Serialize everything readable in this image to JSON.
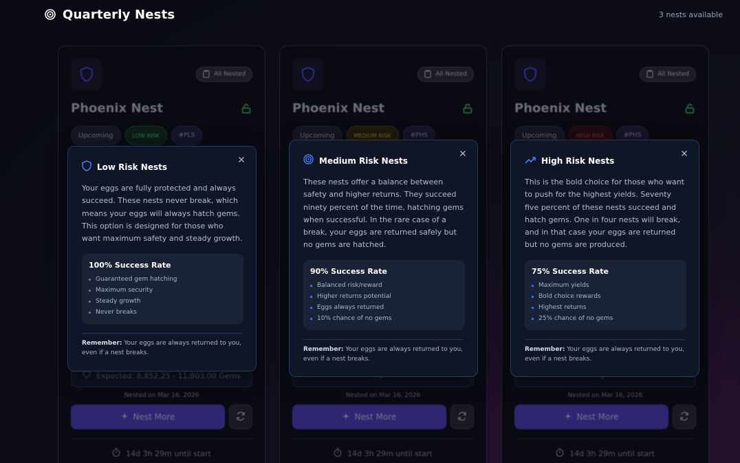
{
  "header": {
    "title": "Quarterly Nests",
    "nests_available": "3 nests available"
  },
  "cards": [
    {
      "all_nested": "All Nested",
      "title": "Phoenix Nest",
      "tags": {
        "status": "Upcoming",
        "risk": "LOW RISK",
        "token": "#PLS"
      },
      "expected": "Expected: 8,852.25 - 11,803.00 Gems",
      "nested_on": "Nested on Mar 16, 2026",
      "nest_button": "Nest More",
      "countdown": "14d 3h 29m until start"
    },
    {
      "all_nested": "All Nested",
      "title": "Phoenix Nest",
      "tags": {
        "status": "Upcoming",
        "risk": "MEDIUM RISK",
        "token": "#PHS"
      },
      "expected": "",
      "nested_on": "Nested on Mar 16, 2026",
      "nest_button": "Nest More",
      "countdown": "14d 3h 29m until start"
    },
    {
      "all_nested": "All Nested",
      "title": "Phoenix Nest",
      "tags": {
        "status": "Upcoming",
        "risk": "HIGH RISK",
        "token": "#PHS"
      },
      "expected": "",
      "nested_on": "Nested on Mar 16, 2026",
      "nest_button": "Nest More",
      "countdown": "14d 3h 29m until start"
    }
  ],
  "popups": [
    {
      "icon": "shield-icon",
      "title": "Low Risk Nests",
      "description": "Your eggs are fully protected and always succeed. These nests never break, which means your eggs will always hatch gems. This option is designed for those who want maximum safety and steady growth.",
      "rate_title": "100% Success Rate",
      "rate_items": [
        "Guaranteed gem hatching",
        "Maximum security",
        "Steady growth",
        "Never breaks"
      ],
      "remember_label": "Remember:",
      "remember_text": " Your eggs are always returned to you, even if a nest breaks."
    },
    {
      "icon": "target-icon",
      "title": "Medium Risk Nests",
      "description": "These nests offer a balance between safety and higher returns. They succeed ninety percent of the time, hatching gems when successful. In the rare case of a break, your eggs are returned safely but no gems are hatched.",
      "rate_title": "90% Success Rate",
      "rate_items": [
        "Balanced risk/reward",
        "Higher returns potential",
        "Eggs always returned",
        "10% chance of no gems"
      ],
      "remember_label": "Remember:",
      "remember_text": " Your eggs are always returned to you, even if a nest breaks."
    },
    {
      "icon": "trending-up-icon",
      "title": "High Risk Nests",
      "description": "This is the bold choice for those who want to push for the highest yields. Seventy five percent of these nests succeed and hatch gems. One in four nests will break, and in that case your eggs are returned but no gems are produced.",
      "rate_title": "75% Success Rate",
      "rate_items": [
        "Maximum yields",
        "Bold choice rewards",
        "Highest returns",
        "25% chance of no gems"
      ],
      "remember_label": "Remember:",
      "remember_text": " Your eggs are always returned to you, even if a nest breaks."
    }
  ],
  "colors": {
    "accent": "#4a7cff",
    "low_risk": "#3ddc7a",
    "medium_risk": "#e8b820",
    "high_risk": "#e04a4a",
    "button": "#4a3fc0"
  }
}
